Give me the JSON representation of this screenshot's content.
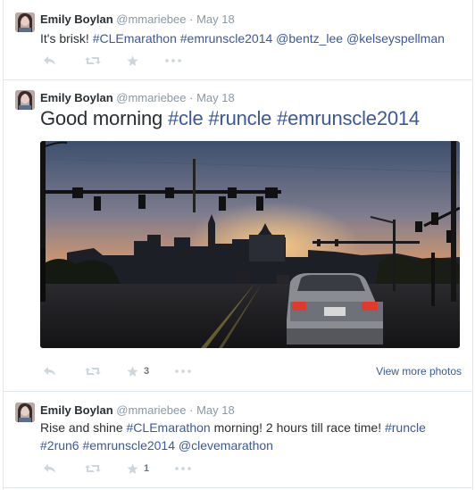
{
  "tweets": [
    {
      "name": "Emily Boylan",
      "handle": "@mmariebee",
      "separator": "·",
      "date": "May 18",
      "segments": [
        {
          "text": "It's brisk! ",
          "tag": false
        },
        {
          "text": "#CLEmarathon",
          "tag": true
        },
        {
          "text": " ",
          "tag": false
        },
        {
          "text": "#emrunscle2014",
          "tag": true
        },
        {
          "text": " ",
          "tag": false
        },
        {
          "text": "@bentz_lee",
          "tag": true
        },
        {
          "text": " ",
          "tag": false
        },
        {
          "text": "@kelseyspellman",
          "tag": true
        }
      ],
      "actions": {
        "reply_icon": "reply-icon",
        "retweet_icon": "retweet-icon",
        "favorite_icon": "star-icon",
        "favorite_count": "",
        "more_icon": "more-icon"
      }
    },
    {
      "name": "Emily Boylan",
      "handle": "@mmariebee",
      "separator": "·",
      "date": "May 18",
      "segments": [
        {
          "text": "Good morning ",
          "tag": false
        },
        {
          "text": "#cle",
          "tag": true
        },
        {
          "text": " ",
          "tag": false
        },
        {
          "text": "#runcle",
          "tag": true
        },
        {
          "text": " ",
          "tag": false
        },
        {
          "text": "#emrunscle2014",
          "tag": true
        }
      ],
      "actions": {
        "reply_icon": "reply-icon",
        "retweet_icon": "retweet-icon",
        "favorite_icon": "star-icon",
        "favorite_count": "3",
        "more_icon": "more-icon"
      },
      "view_more": "View more photos"
    },
    {
      "name": "Emily Boylan",
      "handle": "@mmariebee",
      "separator": "·",
      "date": "May 18",
      "segments": [
        {
          "text": "Rise and shine ",
          "tag": false
        },
        {
          "text": "#CLEmarathon",
          "tag": true
        },
        {
          "text": " morning! 2 hours till race time! ",
          "tag": false
        },
        {
          "text": "#runcle",
          "tag": true
        },
        {
          "text": " ",
          "tag": false
        },
        {
          "text": "#2run6",
          "tag": true
        },
        {
          "text": " ",
          "tag": false
        },
        {
          "text": "#emrunscle2014",
          "tag": true
        },
        {
          "text": " ",
          "tag": false
        },
        {
          "text": "@clevemarathon",
          "tag": true
        }
      ],
      "actions": {
        "reply_icon": "reply-icon",
        "retweet_icon": "retweet-icon",
        "favorite_icon": "star-icon",
        "favorite_count": "1",
        "more_icon": "more-icon"
      }
    }
  ],
  "colors": {
    "link": "#3b5998",
    "meta": "#8899a6",
    "text": "#292f33",
    "icon": "#ccd6dd"
  }
}
